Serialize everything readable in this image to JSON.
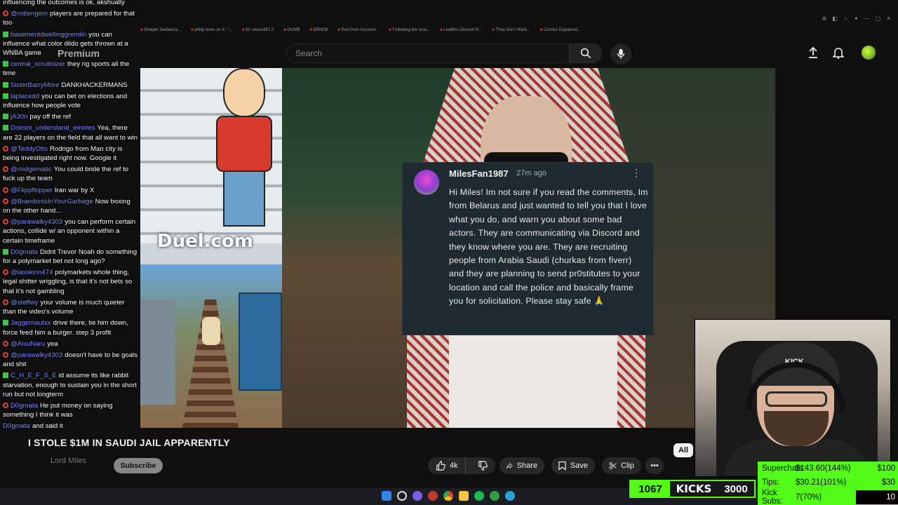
{
  "browser": {
    "bookmarks": [
      "Shayan Sardariza...",
      "philip lewis on X: \"...",
      "lO: olesoul57.2",
      "OUMB",
      "BBNO$",
      "Post from Account...",
      "Following the rece...",
      "Leafkit's Discord R...",
      "They Don't Want...",
      "Comics Explained..."
    ]
  },
  "header": {
    "logo": "Premium",
    "search_placeholder": "Search"
  },
  "video": {
    "overlay_text": "Duel.com",
    "title": "I STOLE $1M IN SAUDI JAIL APPARENTLY",
    "channel": "Lord Miles"
  },
  "comment": {
    "author": "MilesFan1987",
    "time": "27m ago",
    "body": "Hi Miles! Im not sure if you read the comments, Im from Belarus and just wanted to tell you that I love what you do, and warn you about some bad actors. They are communicating via Discord and they know where you are. They are recruiting people from Arabia Saudi (churkas from fiverr) and they are planning to send pr0stitutes to your location and call the police and basically frame you for solicitation. Please stay safe 🙏"
  },
  "webcam": {
    "beanie_text": "KICK"
  },
  "actions": {
    "like_count": "4k",
    "share": "Share",
    "save": "Save",
    "clip": "Clip",
    "subscribe": "Subscribe",
    "filter_chip": "All"
  },
  "chat": {
    "messages": [
      {
        "badge": "none",
        "user": "",
        "user_color": "#ffffff",
        "text": "influencing the outcomes is ok, akshually"
      },
      {
        "badge": "red",
        "user": "@rottengem",
        "user_color": "#7d8cff",
        "text": "players are prepared for that too"
      },
      {
        "badge": "green",
        "user": "basementdwellinggremlin",
        "user_color": "#7d8cff",
        "text": "you can influence what color dildo gets thrown at a WNBA game"
      },
      {
        "badge": "green",
        "user": "central_scrutinizer",
        "user_color": "#7d8cff",
        "text": "they rig sports all the time"
      },
      {
        "badge": "green",
        "user": "SisterBarryMore",
        "user_color": "#7d8cff",
        "text": "DANKHACKERMANS"
      },
      {
        "badge": "green",
        "user": "laplacedd",
        "user_color": "#7d8cff",
        "text": "you can bet on elections and influence how people vote"
      },
      {
        "badge": "green",
        "user": "jA30n",
        "user_color": "#7d8cff",
        "text": "pay off the ref"
      },
      {
        "badge": "green",
        "user": "Doesnt_understand_emotes",
        "user_color": "#7d8cff",
        "text": "Yea, there are 22 players on the field that all want to win"
      },
      {
        "badge": "red",
        "user": "@TeddyOtts",
        "user_color": "#7d8cff",
        "text": "Rodrigo from Man city is being investigated right now. Google it"
      },
      {
        "badge": "red",
        "user": "@midgematic",
        "user_color": "#7d8cff",
        "text": "You could bride the ref to fuck up the team"
      },
      {
        "badge": "red",
        "user": "@Flippflopper",
        "user_color": "#7d8cff",
        "text": "Iran war by X"
      },
      {
        "badge": "red",
        "user": "@BrandonisInYourGarbage",
        "user_color": "#7d8cff",
        "text": "Now boxing on the other hand..."
      },
      {
        "badge": "red",
        "user": "@parawalky4303",
        "user_color": "#7d8cff",
        "text": "you can perform certain actions, collide w/ an opponent within a certain timeframe"
      },
      {
        "badge": "green",
        "user": "D0gmata",
        "user_color": "#7d8cff",
        "text": "Didnt Trevor Noah do something for a polymarket bet not long ago?"
      },
      {
        "badge": "red",
        "user": "@lasskinn474",
        "user_color": "#7d8cff",
        "text": "polymarkets whole thing, legal shitter wriggling, is that it's not bets so that it's not gambling"
      },
      {
        "badge": "red",
        "user": "@steffwy",
        "user_color": "#7d8cff",
        "text": "your volume is much quieter than the video's volume"
      },
      {
        "badge": "green",
        "user": "Jaggernautxx",
        "user_color": "#7d8cff",
        "text": "drive there, tie him down, force feed him a burger. step 3 profit"
      },
      {
        "badge": "red",
        "user": "@AisuNaru",
        "user_color": "#7d8cff",
        "text": "yea"
      },
      {
        "badge": "red",
        "user": "@parawalky4303",
        "user_color": "#7d8cff",
        "text": "doesn't have to be goals and shit"
      },
      {
        "badge": "green",
        "user": "C_H_E_F_S_E",
        "user_color": "#7d8cff",
        "text": "id assume its like rabbit starvation, enough to sustain you in the short run but not longterm"
      },
      {
        "badge": "red",
        "user": "D0gmata",
        "user_color": "#7d8cff",
        "text": "He put money on saying something I think it was"
      },
      {
        "badge": "none",
        "user": "D0gmata",
        "user_color": "#7d8cff",
        "text": "and said it"
      }
    ]
  },
  "kicks": {
    "count": "1067",
    "label": "KICKS",
    "goal": "3000"
  },
  "goals": [
    {
      "label": "Superchats:",
      "value": "$143.60(144%)",
      "target": "$100",
      "progress": 1.0
    },
    {
      "label": "Tips:",
      "value": "$30.21(101%)",
      "target": "$30",
      "progress": 1.0
    },
    {
      "label": "Kick Subs:",
      "value": "7(70%)",
      "target": "10",
      "progress": 0.7
    }
  ],
  "colors": {
    "kick_green": "#53fc18",
    "youtube_bg": "#0f0f0f"
  }
}
